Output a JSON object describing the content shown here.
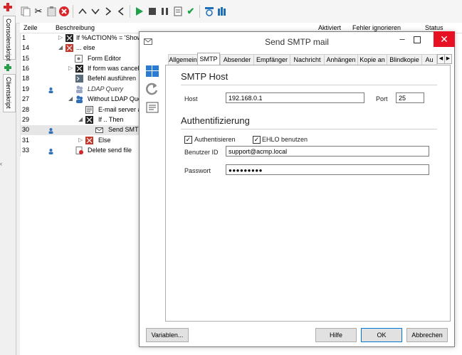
{
  "side_tabs": [
    "Consolenskript",
    "Clientskript"
  ],
  "toolbar_icons": [
    "add-script-icon",
    "copy-icon",
    "cut-icon",
    "paste-icon",
    "delete-icon",
    "move-up-icon",
    "move-down-icon",
    "indent-icon",
    "outdent-icon",
    "run-icon",
    "stop-icon",
    "pause-icon",
    "step-icon",
    "check-icon",
    "debug-icon",
    "variables-icon"
  ],
  "grid": {
    "headers": {
      "line": "Zeile",
      "description": "Beschreibung",
      "active": "Aktiviert",
      "ignore_errors": "Fehler ignorieren",
      "status": "Status"
    },
    "rows": [
      {
        "num": "1",
        "text": "If %ACTION% = 'Show'"
      },
      {
        "num": "14",
        "text": "... else"
      },
      {
        "num": "15",
        "text": "Form Editor"
      },
      {
        "num": "16",
        "text": "If form was cancelled"
      },
      {
        "num": "18",
        "text": "Befehl ausführen"
      },
      {
        "num": "19",
        "text": "LDAP Query"
      },
      {
        "num": "27",
        "text": "Without LDAP Query"
      },
      {
        "num": "28",
        "text": "E-mail server a"
      },
      {
        "num": "29",
        "text": "If .. Then"
      },
      {
        "num": "30",
        "text": "Send SMTP"
      },
      {
        "num": "31",
        "text": "Else"
      },
      {
        "num": "33",
        "text": "Delete send file"
      }
    ]
  },
  "dialog": {
    "title": "Send SMTP mail",
    "minimize": "–",
    "close": "✕",
    "tabs": [
      "Allgemein",
      "SMTP",
      "Absender",
      "Empfänger",
      "Nachricht",
      "Anhängen",
      "Kopie an",
      "Blindkopie",
      "Au"
    ],
    "active_tab": "SMTP",
    "smtp_section": "SMTP Host",
    "host_label": "Host",
    "host_value": "192.168.0.1",
    "port_label": "Port",
    "port_value": "25",
    "auth_section": "Authentifizierung",
    "auth_checkbox": "Authentisieren",
    "ehlo_checkbox": "EHLO benutzen",
    "user_label": "Benutzer ID",
    "user_value": "support@acmp.local",
    "password_label": "Passwort",
    "password_value": "●●●●●●●●●",
    "buttons": {
      "variables": "Variablen...",
      "help": "Hilfe",
      "ok": "OK",
      "cancel": "Abbrechen"
    }
  }
}
